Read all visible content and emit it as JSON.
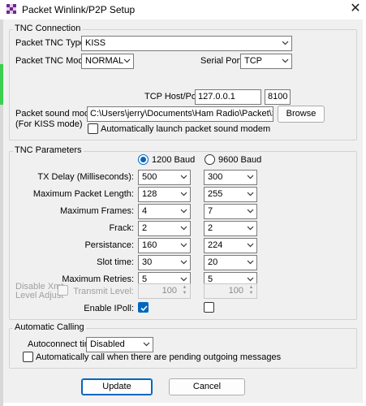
{
  "window": {
    "title": "Packet Winlink/P2P Setup",
    "close_glyph": "✕"
  },
  "tnc_connection": {
    "legend": "TNC Connection",
    "tnc_type_label": "Packet TNC Type:",
    "tnc_type_value": "KISS",
    "tnc_model_label": "Packet TNC Model:",
    "tnc_model_value": "NORMAL",
    "serial_port_label": "Serial Port:",
    "serial_port_value": "TCP",
    "tcp_label": "TCP Host/Port:",
    "tcp_host": "127.0.0.1",
    "tcp_port": "8100",
    "sound_modem_label": "Packet sound modem:",
    "sound_modem_sublabel": "(For KISS mode)",
    "sound_modem_path": "C:\\Users\\jerry\\Documents\\Ham Radio\\Packet\\Soundmoc",
    "browse_label": "Browse",
    "auto_launch_label": "Automatically launch packet sound modem",
    "auto_launch_checked": false
  },
  "tnc_parameters": {
    "legend": "TNC Parameters",
    "baud_1200_label": "1200 Baud",
    "baud_9600_label": "9600 Baud",
    "selected_baud": "1200",
    "rows": [
      {
        "label": "TX Delay (Milliseconds):",
        "v1200": "500",
        "v9600": "300"
      },
      {
        "label": "Maximum Packet Length:",
        "v1200": "128",
        "v9600": "255"
      },
      {
        "label": "Maximum Frames:",
        "v1200": "4",
        "v9600": "7"
      },
      {
        "label": "Frack:",
        "v1200": "2",
        "v9600": "2"
      },
      {
        "label": "Persistance:",
        "v1200": "160",
        "v9600": "224"
      },
      {
        "label": "Slot time:",
        "v1200": "30",
        "v9600": "20"
      },
      {
        "label": "Maximum Retries:",
        "v1200": "5",
        "v9600": "5"
      }
    ],
    "disable_xmt_label_1": "Disable Xmt",
    "disable_xmt_label_2": "Level Adjust",
    "transmit_level_label": "Transmit Level:",
    "transmit_level_1200": "100",
    "transmit_level_9600": "100",
    "enable_ipoll_label": "Enable IPoll:",
    "ipoll_1200_checked": true,
    "ipoll_9600_checked": false
  },
  "automatic_calling": {
    "legend": "Automatic Calling",
    "autoconnect_label": "Autoconnect time:",
    "autoconnect_value": "Disabled",
    "auto_call_label": "Automatically call when there are pending outgoing messages",
    "auto_call_checked": false
  },
  "buttons": {
    "update": "Update",
    "cancel": "Cancel"
  },
  "colors": {
    "accent": "#0067c0",
    "dialog_bg": "#f0f0f0",
    "group_border": "#d3d3d3"
  }
}
